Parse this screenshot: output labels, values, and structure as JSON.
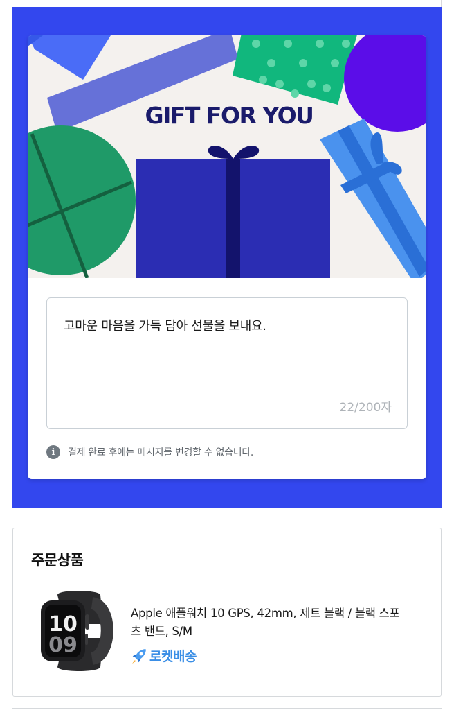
{
  "gift_card": {
    "banner_title": "GIFT FOR YOU",
    "message": "고마운 마음을 가득 담아 선물을 보내요.",
    "char_count_current": "22",
    "char_count_limit": "/200자",
    "notice_icon": "info-icon",
    "notice": "결제 완료 후에는 메시지를 변경할 수 없습니다.",
    "panel_color": "#3347ee"
  },
  "order": {
    "section_title": "주문상품",
    "product_name": "Apple 애플워치 10 GPS, 42mm, 제트 블랙 / 블랙 스포츠 밴드, S/M",
    "watch_display": "10 09",
    "delivery_icon": "rocket-icon",
    "delivery_label": "로켓배송",
    "delivery_color": "#3a8ee6"
  }
}
